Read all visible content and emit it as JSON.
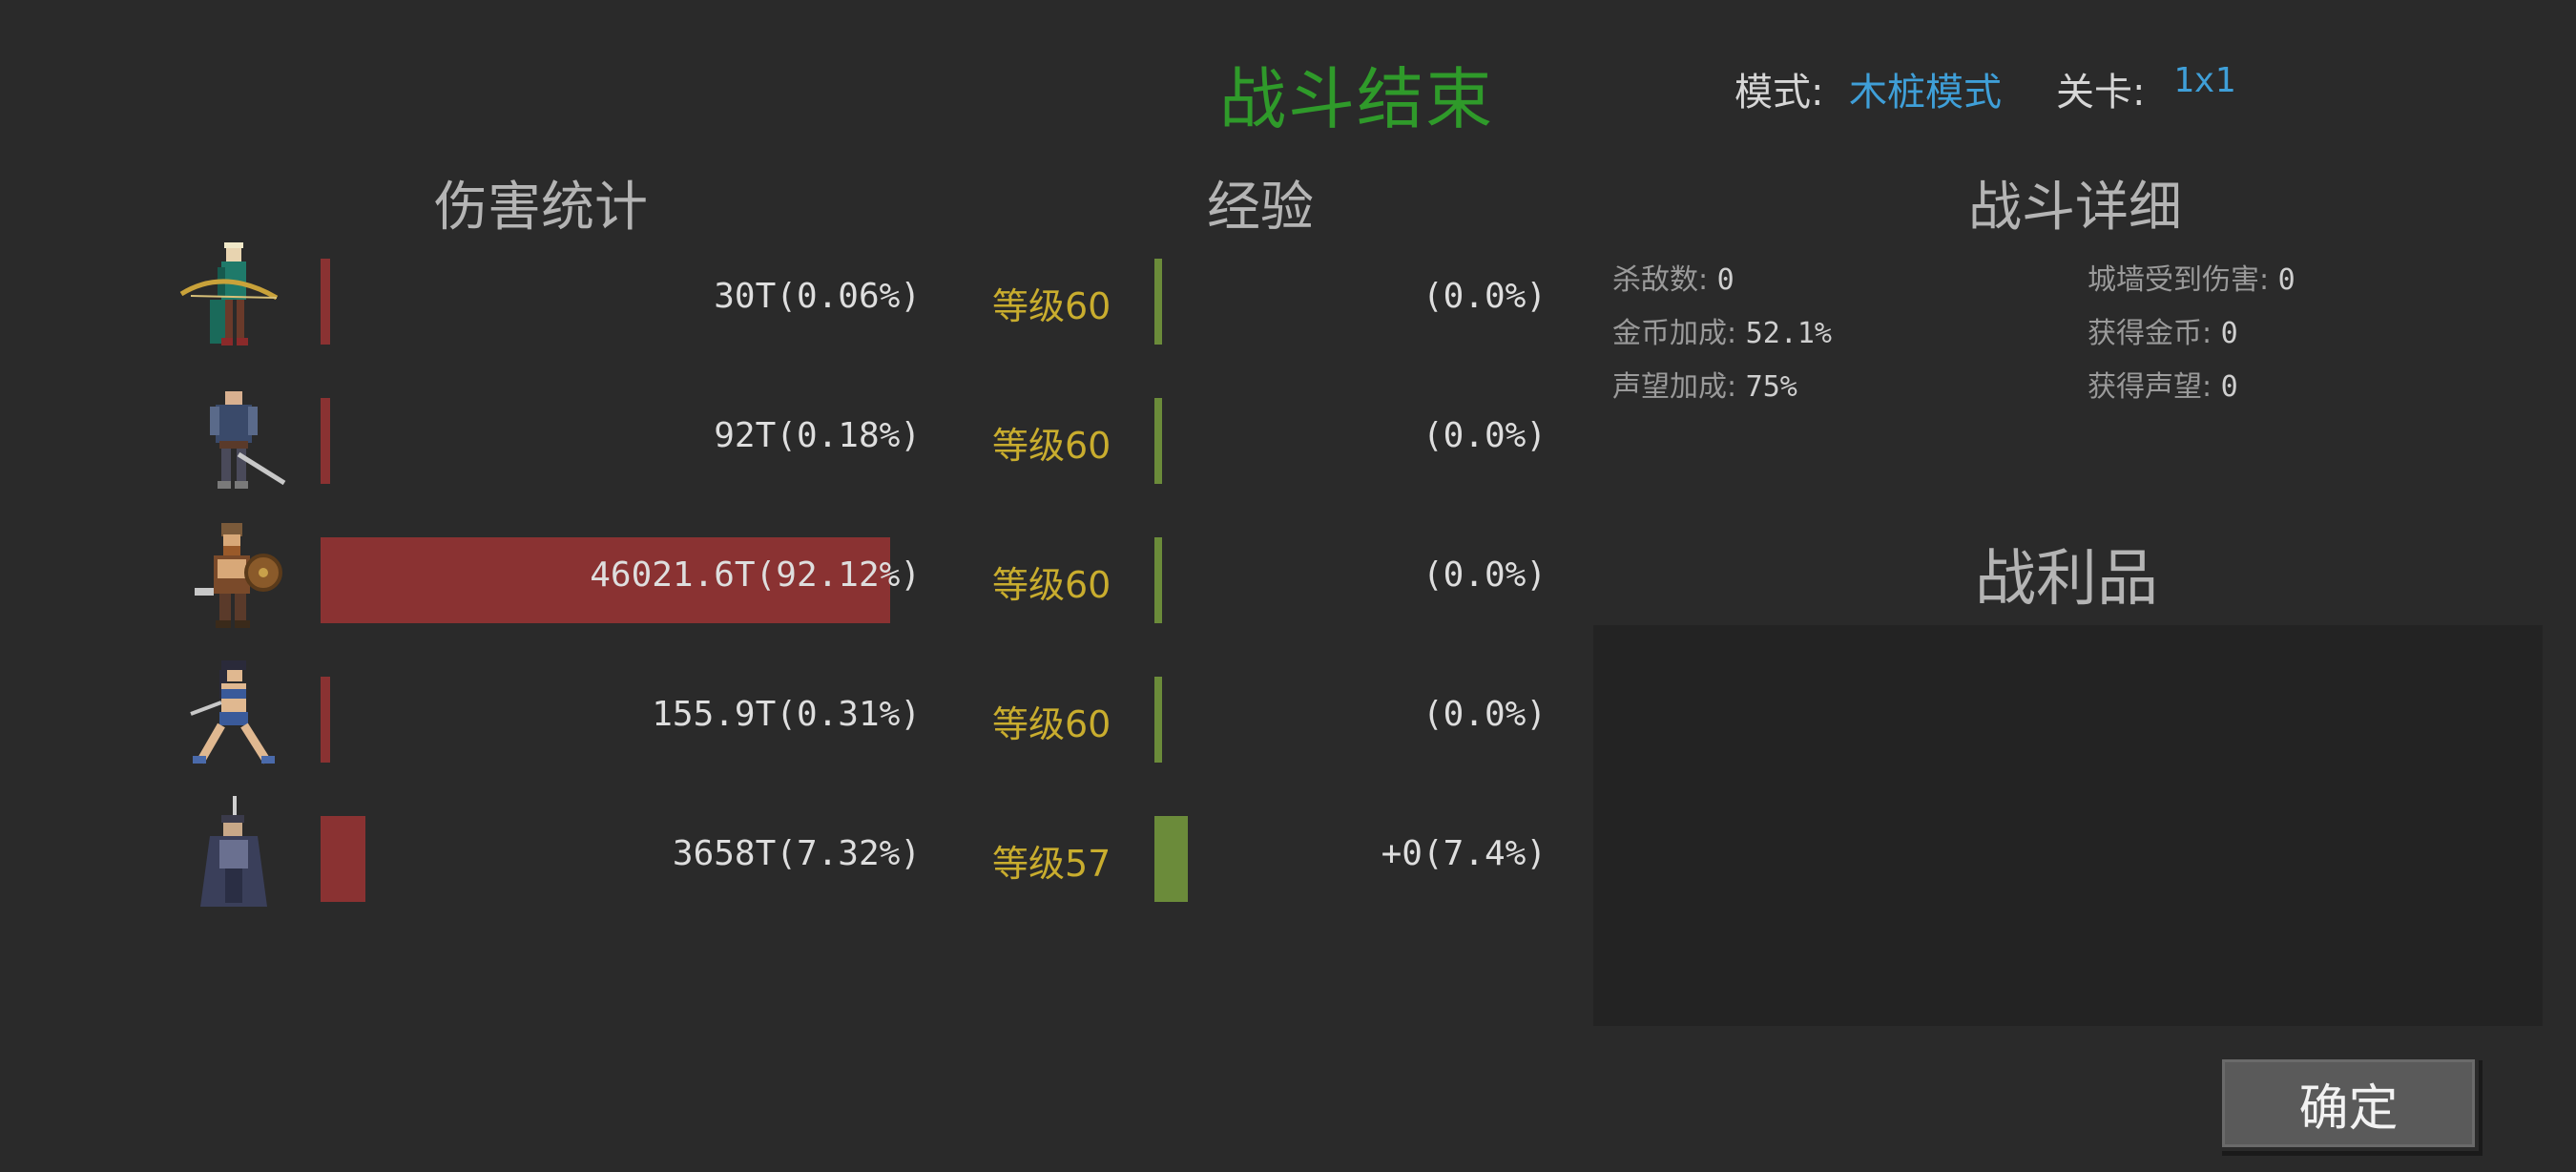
{
  "header": {
    "title": "战斗结束",
    "mode_label": "模式:",
    "mode_value": "木桩模式",
    "level_label": "关卡:",
    "level_value": "1x1"
  },
  "sections": {
    "damage": "伤害统计",
    "experience": "经验",
    "details": "战斗详细",
    "loot": "战利品"
  },
  "heroes": [
    {
      "portrait": "elf-archer-portrait",
      "damage": "30T(0.06%)",
      "damage_share": 0.0006,
      "level": "等级60",
      "exp": "(0.0%)",
      "exp_share": 0.0
    },
    {
      "portrait": "swordsman-portrait",
      "damage": "92T(0.18%)",
      "damage_share": 0.0018,
      "level": "等级60",
      "exp": "(0.0%)",
      "exp_share": 0.0
    },
    {
      "portrait": "viking-shield-warrior-portrait",
      "damage": "46021.6T(92.12%)",
      "damage_share": 0.9212,
      "level": "等级60",
      "exp": "(0.0%)",
      "exp_share": 0.0
    },
    {
      "portrait": "amazon-warrior-portrait",
      "damage": "155.9T(0.31%)",
      "damage_share": 0.0031,
      "level": "等级60",
      "exp": "(0.0%)",
      "exp_share": 0.0
    },
    {
      "portrait": "dark-knight-portrait",
      "damage": "3658T(7.32%)",
      "damage_share": 0.0732,
      "level": "等级57",
      "exp": "+0(7.4%)",
      "exp_share": 0.074
    }
  ],
  "details": {
    "kills_label": "杀敌数:",
    "kills": "0",
    "wall_damage_label": "城墙受到伤害:",
    "wall_damage": "0",
    "gold_bonus_label": "金币加成:",
    "gold_bonus": "52.1%",
    "gold_gained_label": "获得金币:",
    "gold_gained": "0",
    "fame_bonus_label": "声望加成:",
    "fame_bonus": "75%",
    "fame_gained_label": "获得声望:",
    "fame_gained": "0"
  },
  "confirm_label": "确定",
  "colors": {
    "title": "#2f9a2a",
    "accent_blue": "#3f9fd8",
    "damage_bar": "#8a3232",
    "exp_bar": "#6b8b3a",
    "level_text": "#c9ad2e"
  }
}
